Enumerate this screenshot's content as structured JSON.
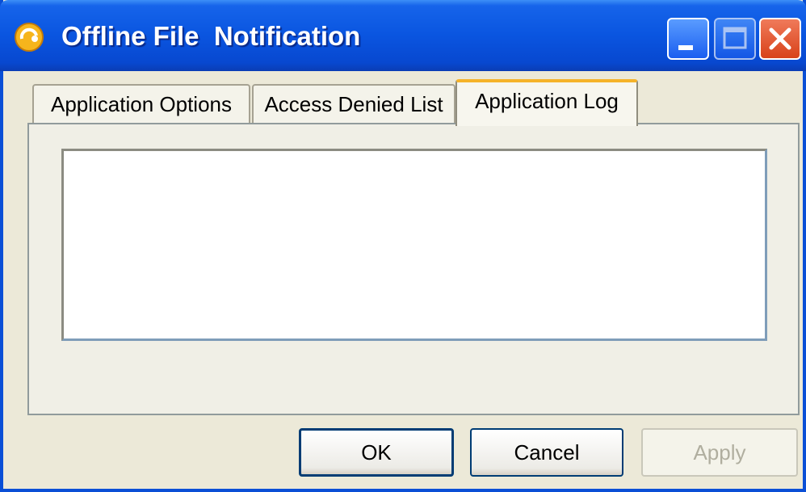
{
  "window": {
    "title": "Offline File  Notification",
    "icon": "offline-file-app-icon",
    "caption_buttons": [
      "minimize",
      "maximize",
      "close"
    ]
  },
  "tabs": [
    {
      "label": "Application Options",
      "selected": false
    },
    {
      "label": "Access Denied List",
      "selected": false
    },
    {
      "label": "Application Log",
      "selected": true
    }
  ],
  "log": {
    "value": ""
  },
  "buttons": {
    "ok": "OK",
    "cancel": "Cancel",
    "apply": "Apply",
    "apply_enabled": false
  },
  "colors": {
    "titlebar": "#0a55e0",
    "background": "#ece9d8",
    "active_tab_accent": "#f5b32a",
    "close_button": "#d8421a"
  }
}
